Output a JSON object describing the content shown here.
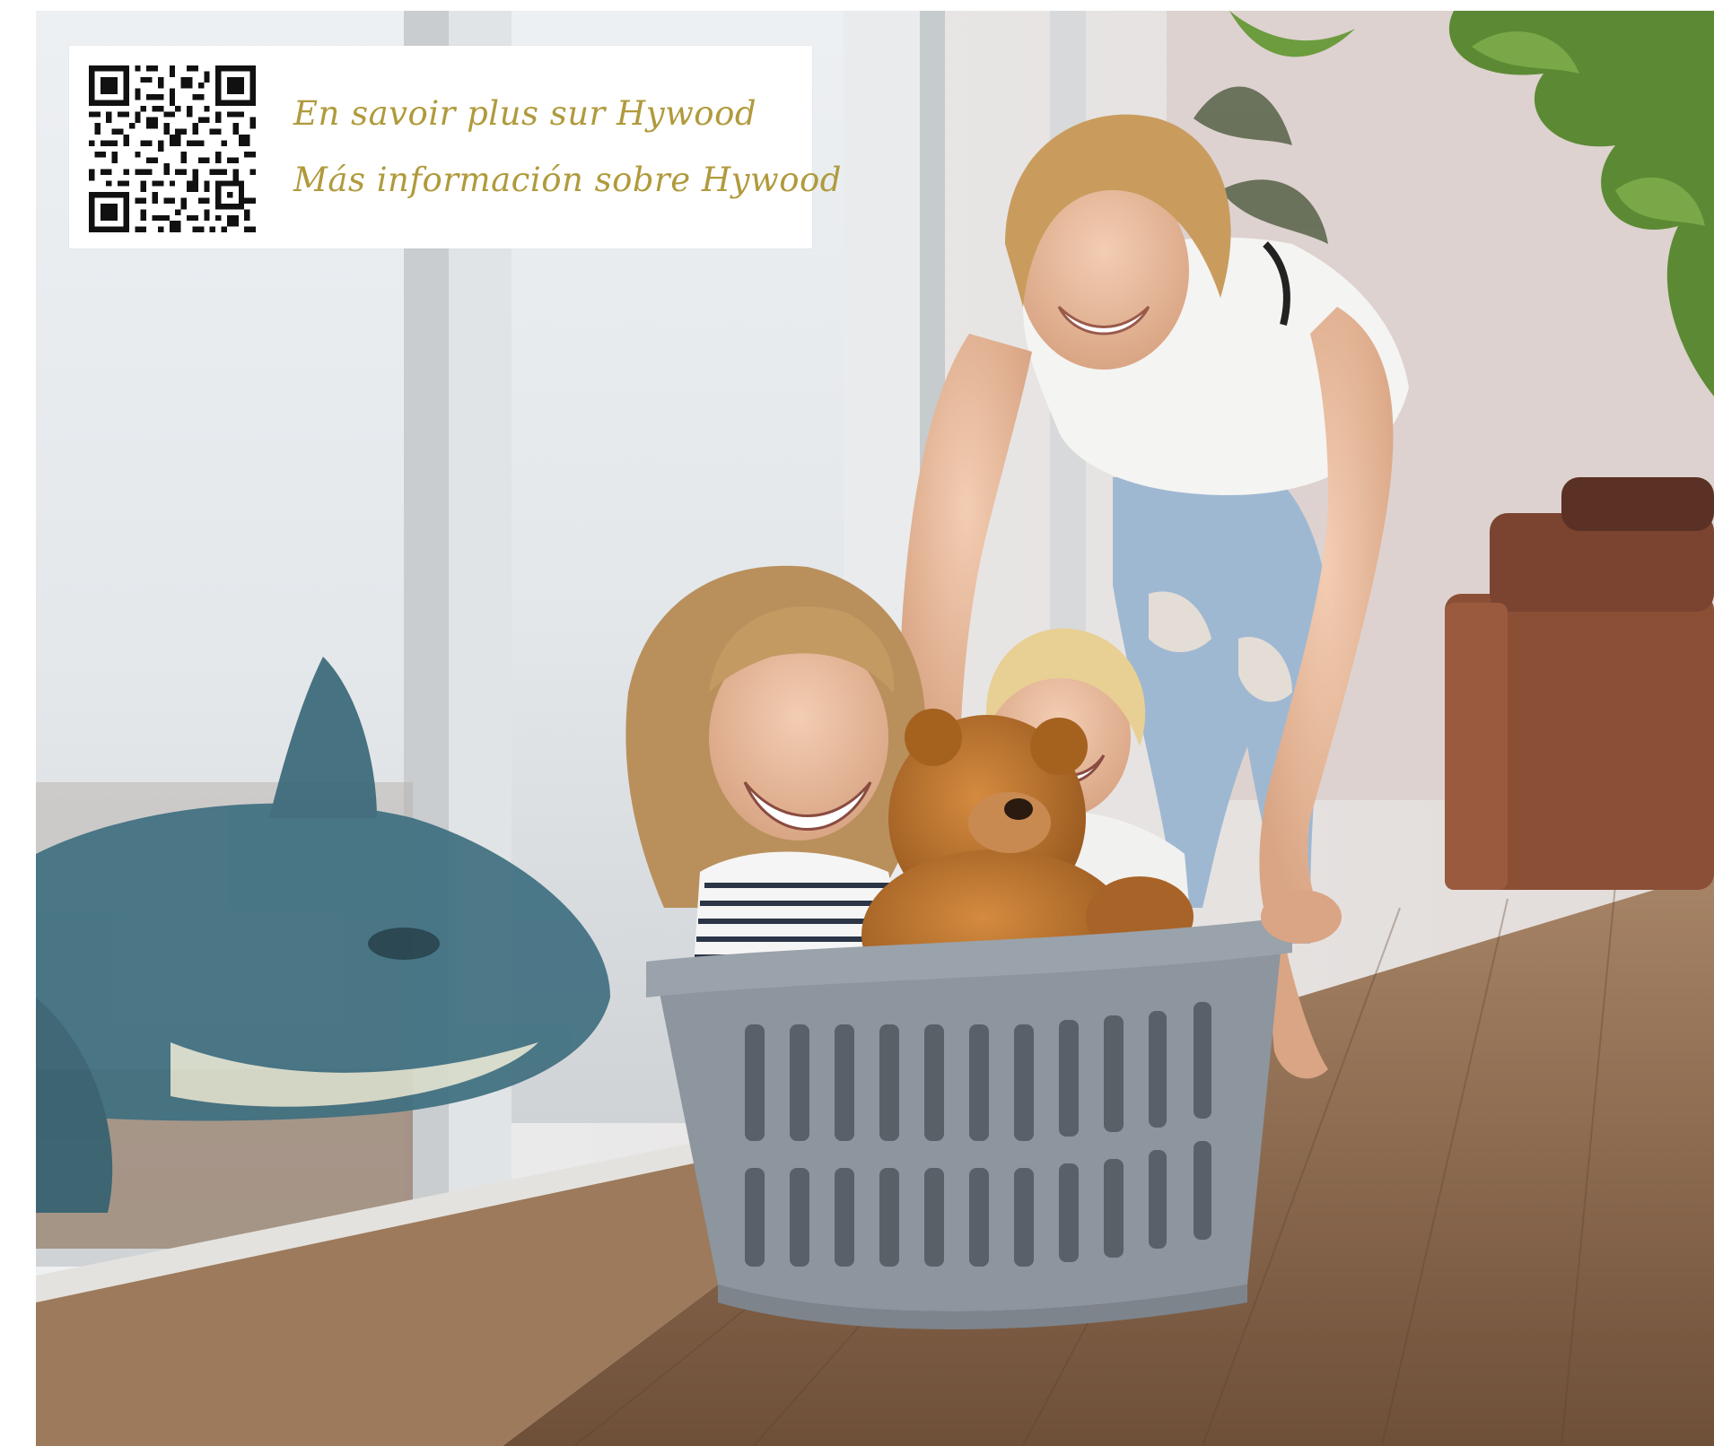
{
  "info_card": {
    "line_fr": "En savoir plus sur Hywood",
    "line_es": "Más información sobre Hywood",
    "text_color": "#b09a3c",
    "qr_icon": "qr-code-icon"
  },
  "photo": {
    "subject": "photo-family-playing-laundry-basket"
  },
  "colors": {
    "wall": "#e6e9ec",
    "floor": "#8a6446",
    "basket": "#8d959e",
    "sofa": "#8b4f36",
    "plant": "#4f7a2e"
  }
}
